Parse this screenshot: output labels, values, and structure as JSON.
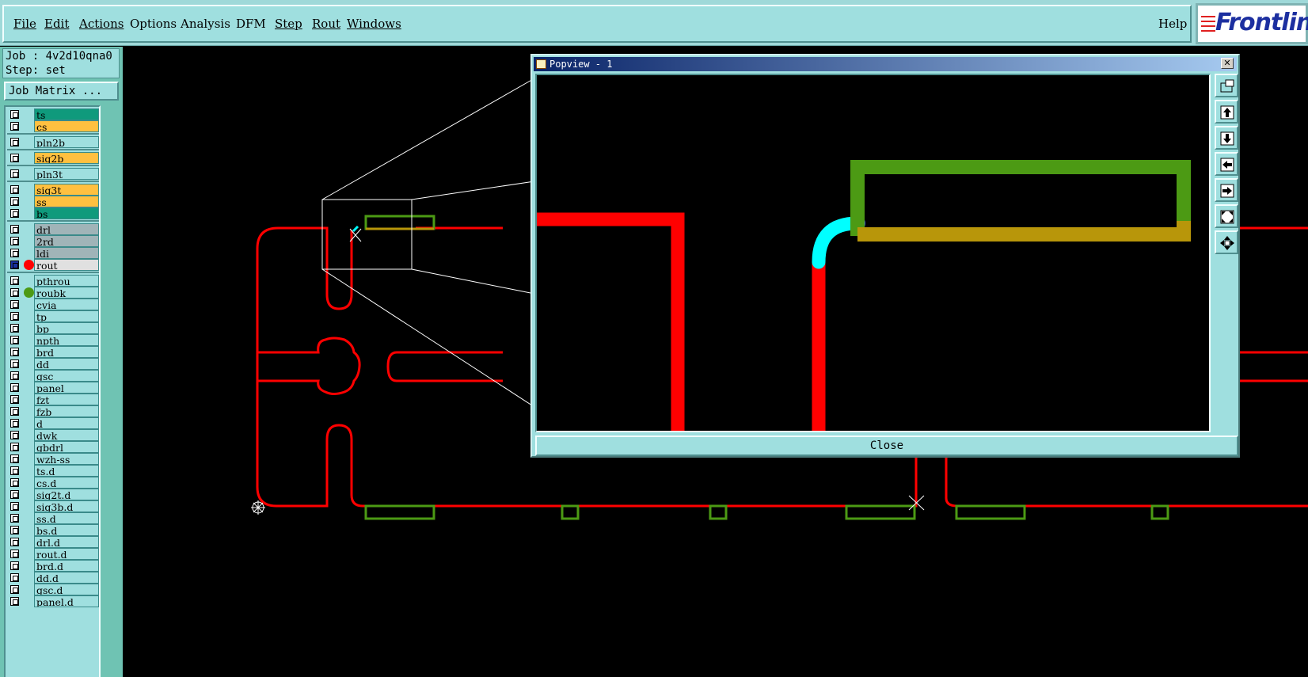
{
  "menu": {
    "items": [
      "File",
      "Edit",
      "Actions",
      "Options",
      "Analysis",
      "DFM",
      "Step",
      "Rout",
      "Windows"
    ],
    "help": "Help"
  },
  "logo": {
    "text": "Frontline"
  },
  "job": {
    "job_line": "Job : 4v2d10qna0",
    "step_line": "Step: set",
    "matrix_button": "Job Matrix ..."
  },
  "layers": [
    {
      "name": "ts",
      "color": "#0f9a7c",
      "text_color": "#000"
    },
    {
      "name": "cs",
      "color": "#ffc040",
      "text_color": "#000"
    },
    {
      "name": "pln2b",
      "color": "#9fdfdf",
      "text_color": "#000"
    },
    {
      "name": "sig2b",
      "color": "#ffc040",
      "text_color": "#000"
    },
    {
      "name": "pln3t",
      "color": "#9fdfdf",
      "text_color": "#000"
    },
    {
      "name": "sig3t",
      "color": "#ffc040",
      "text_color": "#000"
    },
    {
      "name": "ss",
      "color": "#ffc040",
      "text_color": "#000"
    },
    {
      "name": "bs",
      "color": "#0f9a7c",
      "text_color": "#000"
    },
    {
      "name": "drl",
      "color": "#a0b4b8",
      "text_color": "#000"
    },
    {
      "name": "2rd",
      "color": "#a0b4b8",
      "text_color": "#000"
    },
    {
      "name": "ldi",
      "color": "#a0b4b8",
      "text_color": "#000"
    },
    {
      "name": "rout",
      "color": "#e0e0e0",
      "text_color": "#000",
      "dot": "#ff0000",
      "active": true
    },
    {
      "name": "pthrou",
      "color": "#9fdfdf",
      "text_color": "#000"
    },
    {
      "name": "roubk",
      "color": "#9fdfdf",
      "text_color": "#000",
      "dot": "#4c9a14"
    },
    {
      "name": "cvia",
      "color": "#9fdfdf",
      "text_color": "#000"
    },
    {
      "name": "tp",
      "color": "#9fdfdf",
      "text_color": "#000"
    },
    {
      "name": "bp",
      "color": "#9fdfdf",
      "text_color": "#000"
    },
    {
      "name": "npth",
      "color": "#9fdfdf",
      "text_color": "#000"
    },
    {
      "name": "brd",
      "color": "#9fdfdf",
      "text_color": "#000"
    },
    {
      "name": "dd",
      "color": "#9fdfdf",
      "text_color": "#000"
    },
    {
      "name": "gsc",
      "color": "#9fdfdf",
      "text_color": "#000"
    },
    {
      "name": "panel",
      "color": "#9fdfdf",
      "text_color": "#000"
    },
    {
      "name": "fzt",
      "color": "#9fdfdf",
      "text_color": "#000"
    },
    {
      "name": "fzb",
      "color": "#9fdfdf",
      "text_color": "#000"
    },
    {
      "name": "d",
      "color": "#9fdfdf",
      "text_color": "#000"
    },
    {
      "name": "dwk",
      "color": "#9fdfdf",
      "text_color": "#000"
    },
    {
      "name": "gbdrl",
      "color": "#9fdfdf",
      "text_color": "#000"
    },
    {
      "name": "wzh-ss",
      "color": "#9fdfdf",
      "text_color": "#000"
    },
    {
      "name": "ts.d",
      "color": "#9fdfdf",
      "text_color": "#000"
    },
    {
      "name": "cs.d",
      "color": "#9fdfdf",
      "text_color": "#000"
    },
    {
      "name": "sig2t.d",
      "color": "#9fdfdf",
      "text_color": "#000"
    },
    {
      "name": "sig3b.d",
      "color": "#9fdfdf",
      "text_color": "#000"
    },
    {
      "name": "ss.d",
      "color": "#9fdfdf",
      "text_color": "#000"
    },
    {
      "name": "bs.d",
      "color": "#9fdfdf",
      "text_color": "#000"
    },
    {
      "name": "drl.d",
      "color": "#9fdfdf",
      "text_color": "#000"
    },
    {
      "name": "rout.d",
      "color": "#9fdfdf",
      "text_color": "#000"
    },
    {
      "name": "brd.d",
      "color": "#9fdfdf",
      "text_color": "#000"
    },
    {
      "name": "dd.d",
      "color": "#9fdfdf",
      "text_color": "#000"
    },
    {
      "name": "gsc.d",
      "color": "#9fdfdf",
      "text_color": "#000"
    },
    {
      "name": "panel.d",
      "color": "#9fdfdf",
      "text_color": "#000"
    }
  ],
  "popview": {
    "title": "Popview - 1",
    "close_x": "✕",
    "close_button": "Close",
    "tools": [
      "zoom-window-icon",
      "pan-up-icon",
      "pan-down-icon",
      "pan-left-icon",
      "pan-right-icon",
      "zoom-fit-icon",
      "zoom-home-icon"
    ]
  },
  "colors": {
    "rout": "#ff0000",
    "pad_green": "#4c9a14",
    "pad_olive": "#b8960a",
    "highlight_cyan": "#00ffff",
    "ui_bg": "#9fdfdf"
  }
}
